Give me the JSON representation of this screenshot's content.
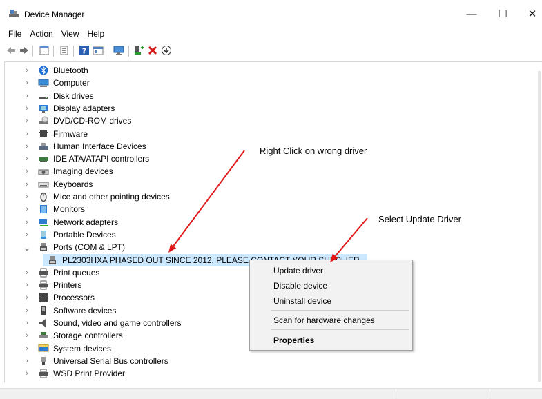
{
  "window": {
    "title": "Device Manager",
    "minimize": "—",
    "maximize": "☐",
    "close": "✕"
  },
  "menu": [
    "File",
    "Action",
    "View",
    "Help"
  ],
  "toolbar_icons": [
    "back-icon",
    "forward-icon",
    "properties-icon",
    "list-icon",
    "help-icon",
    "view-icon",
    "monitor-icon",
    "add-driver-icon",
    "uninstall-icon",
    "update-driver-icon"
  ],
  "tree": [
    {
      "label": "Bluetooth",
      "icon": "bluetooth-icon",
      "color": "#1e6fd6"
    },
    {
      "label": "Computer",
      "icon": "computer-icon",
      "color": "#3a8fd8"
    },
    {
      "label": "Disk drives",
      "icon": "disk-drive-icon",
      "color": "#555555"
    },
    {
      "label": "Display adapters",
      "icon": "display-adapter-icon",
      "color": "#2f7bd1"
    },
    {
      "label": "DVD/CD-ROM drives",
      "icon": "dvd-drive-icon",
      "color": "#777777"
    },
    {
      "label": "Firmware",
      "icon": "firmware-icon",
      "color": "#444444"
    },
    {
      "label": "Human Interface Devices",
      "icon": "hid-icon",
      "color": "#5a6a80"
    },
    {
      "label": "IDE ATA/ATAPI controllers",
      "icon": "ide-controller-icon",
      "color": "#3a7a3a"
    },
    {
      "label": "Imaging devices",
      "icon": "imaging-icon",
      "color": "#555555"
    },
    {
      "label": "Keyboards",
      "icon": "keyboard-icon",
      "color": "#666666"
    },
    {
      "label": "Mice and other pointing devices",
      "icon": "mouse-icon",
      "color": "#444444"
    },
    {
      "label": "Monitors",
      "icon": "monitor-icon",
      "color": "#2f7bd1"
    },
    {
      "label": "Network adapters",
      "icon": "network-adapter-icon",
      "color": "#2f7bd1"
    },
    {
      "label": "Portable Devices",
      "icon": "portable-device-icon",
      "color": "#3a8fd8"
    },
    {
      "label": "Ports (COM & LPT)",
      "icon": "port-icon",
      "color": "#555555",
      "expanded": true
    },
    {
      "label": "Print queues",
      "icon": "printer-icon",
      "color": "#555555"
    },
    {
      "label": "Printers",
      "icon": "printer-icon",
      "color": "#555555"
    },
    {
      "label": "Processors",
      "icon": "processor-icon",
      "color": "#444444"
    },
    {
      "label": "Software devices",
      "icon": "software-device-icon",
      "color": "#444444"
    },
    {
      "label": "Sound, video and game controllers",
      "icon": "sound-icon",
      "color": "#555555"
    },
    {
      "label": "Storage controllers",
      "icon": "storage-controller-icon",
      "color": "#3a7a3a"
    },
    {
      "label": "System devices",
      "icon": "system-device-icon",
      "color": "#2f7bd1"
    },
    {
      "label": "Universal Serial Bus controllers",
      "icon": "usb-icon",
      "color": "#444444"
    },
    {
      "label": "WSD Print Provider",
      "icon": "printer-icon",
      "color": "#555555"
    }
  ],
  "selected_child": {
    "label": "PL2303HXA PHASED OUT SINCE 2012. PLEASE CONTACT YOUR SUPPLIER.",
    "icon": "port-icon"
  },
  "context_menu": {
    "items": [
      {
        "label": "Update driver"
      },
      {
        "label": "Disable device"
      },
      {
        "label": "Uninstall device"
      },
      {
        "label": "Scan for hardware changes"
      },
      {
        "label": "Properties",
        "bold": true
      }
    ]
  },
  "annotations": {
    "right_click": "Right Click on wrong driver",
    "select_update": "Select Update Driver",
    "arrow_color": "#e01818"
  }
}
